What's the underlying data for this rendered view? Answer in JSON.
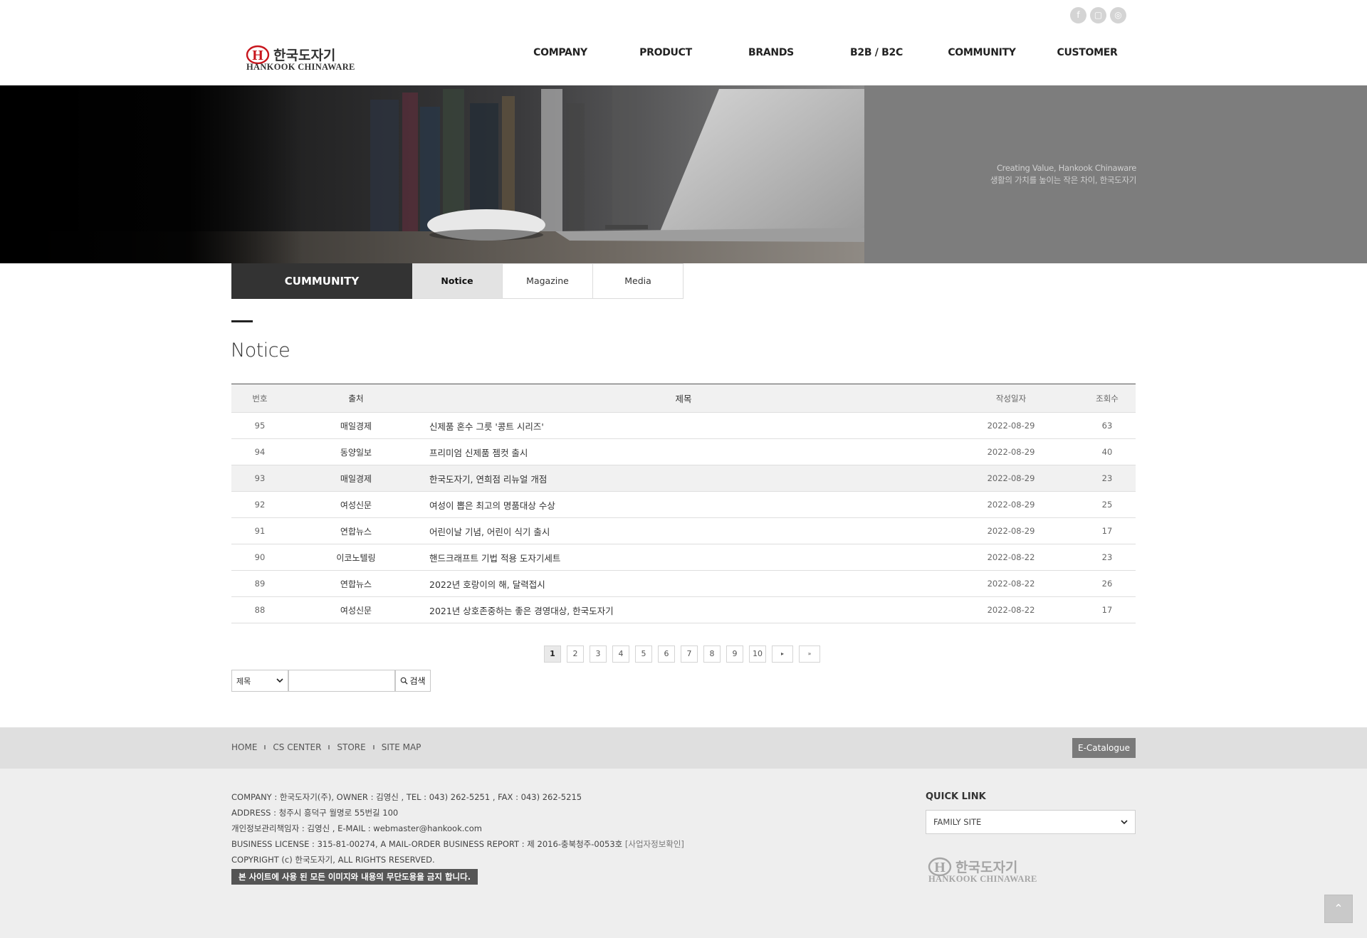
{
  "header": {
    "social": [
      {
        "icon": "facebook-icon",
        "glyph": "f"
      },
      {
        "icon": "blog-icon",
        "glyph": "▢"
      },
      {
        "icon": "instagram-icon",
        "glyph": "◎"
      }
    ],
    "logo": {
      "korean": "한국도자기",
      "english": "HANKOOK CHINAWARE",
      "mark": "H"
    },
    "nav": [
      "COMPANY",
      "PRODUCT",
      "BRANDS",
      "B2B / B2C",
      "COMMUNITY",
      "CUSTOMER"
    ]
  },
  "hero": {
    "tagline_en": "Creating Value, Hankook Chinaware",
    "tagline_ko": "생활의 가치를 높이는 작은 차이, 한국도자기"
  },
  "subnav": {
    "title": "CUMMUNITY",
    "tabs": [
      "Notice",
      "Magazine",
      "Media"
    ],
    "active": "Notice"
  },
  "page_title": "Notice",
  "table": {
    "headers": [
      "번호",
      "출처",
      "제목",
      "작성일자",
      "조회수"
    ],
    "rows": [
      {
        "num": "95",
        "source": "매일경제",
        "title": "신제품 혼수 그릇 '콩트 시리즈'",
        "date": "2022-08-29",
        "views": "63"
      },
      {
        "num": "94",
        "source": "동양일보",
        "title": "프리미엄 신제품 젬컷 출시",
        "date": "2022-08-29",
        "views": "40"
      },
      {
        "num": "93",
        "source": "매일경제",
        "title": "한국도자기, 연희점 리뉴얼 개점",
        "date": "2022-08-29",
        "views": "23"
      },
      {
        "num": "92",
        "source": "여성신문",
        "title": "여성이 뽑은 최고의 명품대상 수상",
        "date": "2022-08-29",
        "views": "25"
      },
      {
        "num": "91",
        "source": "연합뉴스",
        "title": "어린이날 기념, 어린이 식기 출시",
        "date": "2022-08-29",
        "views": "17"
      },
      {
        "num": "90",
        "source": "이코노텔링",
        "title": "핸드크래프트 기법 적용 도자기세트",
        "date": "2022-08-22",
        "views": "23"
      },
      {
        "num": "89",
        "source": "연합뉴스",
        "title": "2022년 호랑이의 해, 달력접시",
        "date": "2022-08-22",
        "views": "26"
      },
      {
        "num": "88",
        "source": "여성신문",
        "title": "2021년 상호존중하는 좋은 경영대상, 한국도자기",
        "date": "2022-08-22",
        "views": "17"
      }
    ],
    "highlight_row": 2
  },
  "pagination": {
    "pages": [
      "1",
      "2",
      "3",
      "4",
      "5",
      "6",
      "7",
      "8",
      "9",
      "10"
    ],
    "current": "1",
    "next_glyph": "▸",
    "last_glyph": "»"
  },
  "search": {
    "field": "제목",
    "button": "검색",
    "value": ""
  },
  "footer_links": {
    "items": [
      "HOME",
      "CS CENTER",
      "STORE",
      "SITE MAP"
    ],
    "ecatalogue": "E-Catalogue"
  },
  "footer": {
    "line1": "COMPANY : 한국도자기(주), OWNER : 김영신 , TEL : 043) 262-5251 , FAX : 043) 262-5215",
    "line2": "ADDRESS : 청주시 흥덕구 월명로 55번길 100",
    "line3": "개인정보관리책임자 : 김영신 , E-MAIL : webmaster@hankook.com",
    "line4": "BUSINESS LICENSE : 315-81-00274, A MAIL-ORDER BUSINESS REPORT : 제 2016-충북청주-0053호",
    "line4_link": "[사업자정보확인]",
    "line5": "COPYRIGHT (c) 한국도자기, ALL RIGHTS RESERVED.",
    "notice": "본 사이트에 사용 된 모든 이미지와 내용의 무단도용을 금지 합니다.",
    "quick_link_title": "QUICK LINK",
    "quick_link_select": "FAMILY SITE",
    "top_glyph": "⌃"
  },
  "colors": {
    "brand_red": "#c8161d",
    "dark": "#333333",
    "hero_gray": "#7d7d7d"
  }
}
